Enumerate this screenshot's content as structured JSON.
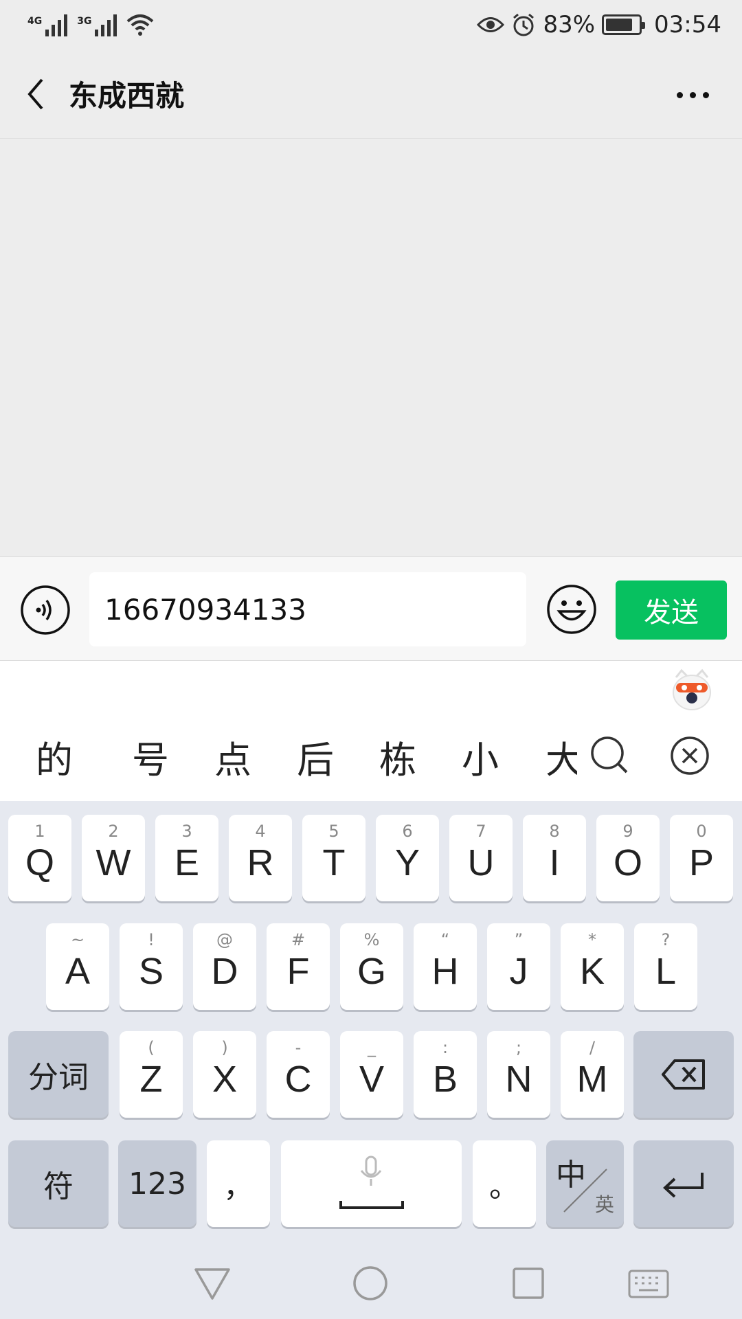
{
  "status_bar": {
    "net1": "4G",
    "net2": "3G",
    "battery_percent": "83%",
    "battery_level": 0.83,
    "time": "03:54"
  },
  "header": {
    "title": "东成西就"
  },
  "input": {
    "value": "16670934133",
    "send_label": "发送"
  },
  "candidates": [
    "的",
    "号",
    "点",
    "后",
    "栋",
    "小",
    "大"
  ],
  "keyboard": {
    "row1": [
      {
        "sub": "1",
        "main": "Q"
      },
      {
        "sub": "2",
        "main": "W"
      },
      {
        "sub": "3",
        "main": "E"
      },
      {
        "sub": "4",
        "main": "R"
      },
      {
        "sub": "5",
        "main": "T"
      },
      {
        "sub": "6",
        "main": "Y"
      },
      {
        "sub": "7",
        "main": "U"
      },
      {
        "sub": "8",
        "main": "I"
      },
      {
        "sub": "9",
        "main": "O"
      },
      {
        "sub": "0",
        "main": "P"
      }
    ],
    "row2": [
      {
        "sub": "~",
        "main": "A"
      },
      {
        "sub": "!",
        "main": "S"
      },
      {
        "sub": "@",
        "main": "D"
      },
      {
        "sub": "#",
        "main": "F"
      },
      {
        "sub": "%",
        "main": "G"
      },
      {
        "sub": "“",
        "main": "H"
      },
      {
        "sub": "”",
        "main": "J"
      },
      {
        "sub": "*",
        "main": "K"
      },
      {
        "sub": "?",
        "main": "L"
      }
    ],
    "row3": [
      {
        "sub": "(",
        "main": "Z"
      },
      {
        "sub": ")",
        "main": "X"
      },
      {
        "sub": "-",
        "main": "C"
      },
      {
        "sub": "_",
        "main": "V"
      },
      {
        "sub": ":",
        "main": "B"
      },
      {
        "sub": ";",
        "main": "N"
      },
      {
        "sub": "/",
        "main": "M"
      }
    ],
    "segment_label": "分词",
    "symbol_label": "符",
    "num_label": "123",
    "comma_label": "，",
    "period_label": "。",
    "lang_zh": "中",
    "lang_en": "英"
  },
  "colors": {
    "send_green": "#07c160",
    "background": "#ededed"
  }
}
